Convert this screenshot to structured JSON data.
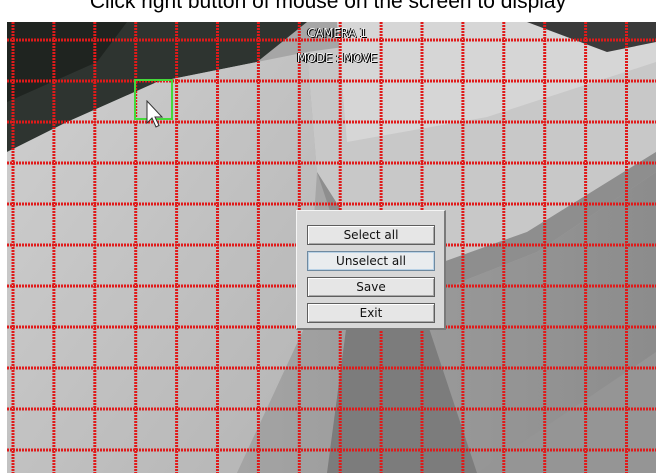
{
  "header": {
    "instruction": "Click right button of mouse on the screen to display"
  },
  "osd": {
    "camera_label": "CAMERA 1",
    "mode_label": "MODE : MOVE"
  },
  "menu": {
    "items": [
      {
        "label": "Select all"
      },
      {
        "label": "Unselect all"
      },
      {
        "label": "Save"
      },
      {
        "label": "Exit"
      }
    ]
  },
  "grid": {
    "columns": 16,
    "rows": 11,
    "line_color": "#e01a1a",
    "selected_color": "#45d93a"
  }
}
